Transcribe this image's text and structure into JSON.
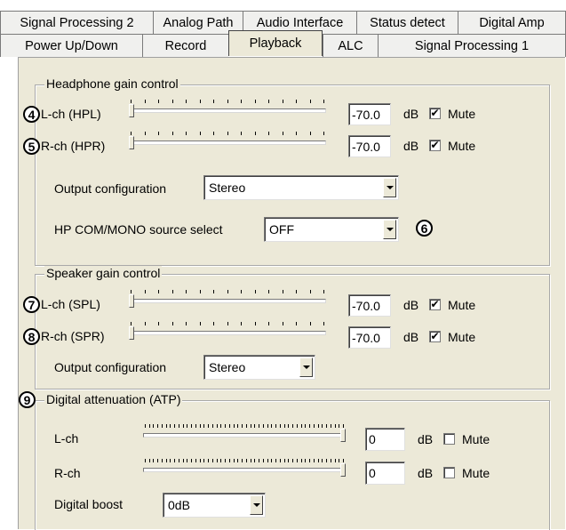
{
  "tabs_row1": [
    "Signal Processing 2",
    "Analog Path",
    "Audio Interface",
    "Status detect",
    "Digital Amp"
  ],
  "tabs_row2": [
    "Power Up/Down",
    "Record",
    "Playback",
    "ALC",
    "Signal Processing 1"
  ],
  "active_tab": "Playback",
  "headphone": {
    "title": "Headphone gain control",
    "left": {
      "badge": "4",
      "label": "L-ch (HPL)",
      "value": "-70.0",
      "unit": "dB",
      "mute_label": "Mute",
      "muted": true,
      "level": 0
    },
    "right": {
      "badge": "5",
      "label": "R-ch (HPR)",
      "value": "-70.0",
      "unit": "dB",
      "mute_label": "Mute",
      "muted": true,
      "level": 0
    },
    "output_config_label": "Output configuration",
    "output_config_value": "Stereo",
    "hp_com_label": "HP COM/MONO source select",
    "hp_com_value": "OFF",
    "hp_com_badge": "6"
  },
  "speaker": {
    "title": "Speaker gain control",
    "left": {
      "badge": "7",
      "label": "L-ch (SPL)",
      "value": "-70.0",
      "unit": "dB",
      "mute_label": "Mute",
      "muted": true,
      "level": 0
    },
    "right": {
      "badge": "8",
      "label": "R-ch (SPR)",
      "value": "-70.0",
      "unit": "dB",
      "mute_label": "Mute",
      "muted": true,
      "level": 0
    },
    "output_config_label": "Output configuration",
    "output_config_value": "Stereo"
  },
  "digital": {
    "badge": "9",
    "title": "Digital attenuation (ATP)",
    "left": {
      "label": "L-ch",
      "value": "0",
      "unit": "dB",
      "mute_label": "Mute",
      "muted": false,
      "level": 1
    },
    "right": {
      "label": "R-ch",
      "value": "0",
      "unit": "dB",
      "mute_label": "Mute",
      "muted": false,
      "level": 1
    },
    "boost_label": "Digital boost",
    "boost_value": "0dB"
  }
}
